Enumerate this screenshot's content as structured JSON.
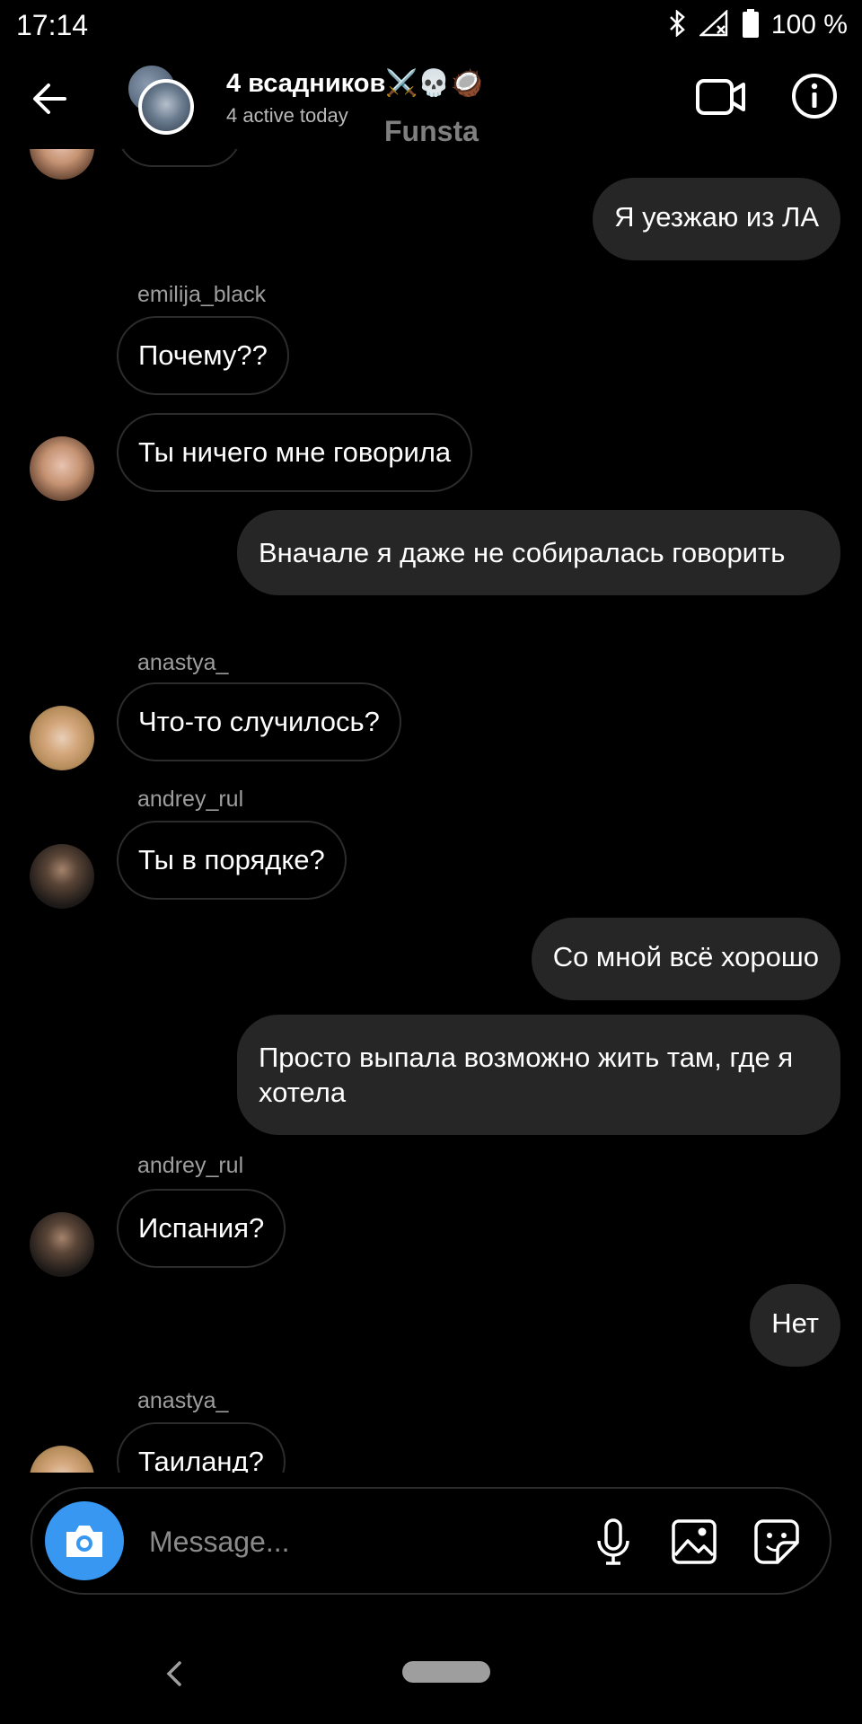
{
  "status_bar": {
    "time": "17:14",
    "battery": "100 %"
  },
  "header": {
    "title": "4 всадников⚔️💀🥥",
    "subtitle": "4 active today",
    "watermark": "Funsta"
  },
  "messages": {
    "m1": {
      "text": "Я уезжаю из ЛА"
    },
    "m2": {
      "sender": "emilija_black",
      "text": "Почему??"
    },
    "m3": {
      "text": "Ты ничего мне говорила"
    },
    "m4": {
      "text": "Вначале я даже не собиралась говорить"
    },
    "m5": {
      "sender": "anastya_",
      "text": "Что-то случилось?"
    },
    "m6": {
      "sender": "andrey_rul",
      "text": "Ты в порядке?"
    },
    "m7": {
      "text": "Со мной всё хорошо"
    },
    "m8": {
      "text": "Просто выпала возможно жить там, где я хотела"
    },
    "m9": {
      "sender": "andrey_rul",
      "text": "Испания?"
    },
    "m10": {
      "text": "Нет"
    },
    "m11": {
      "sender": "anastya_",
      "text": "Таиланд?"
    }
  },
  "composer": {
    "placeholder": "Message..."
  },
  "colors": {
    "accent": "#3897f0",
    "outgoing_bubble": "#262626",
    "background": "#000000"
  }
}
